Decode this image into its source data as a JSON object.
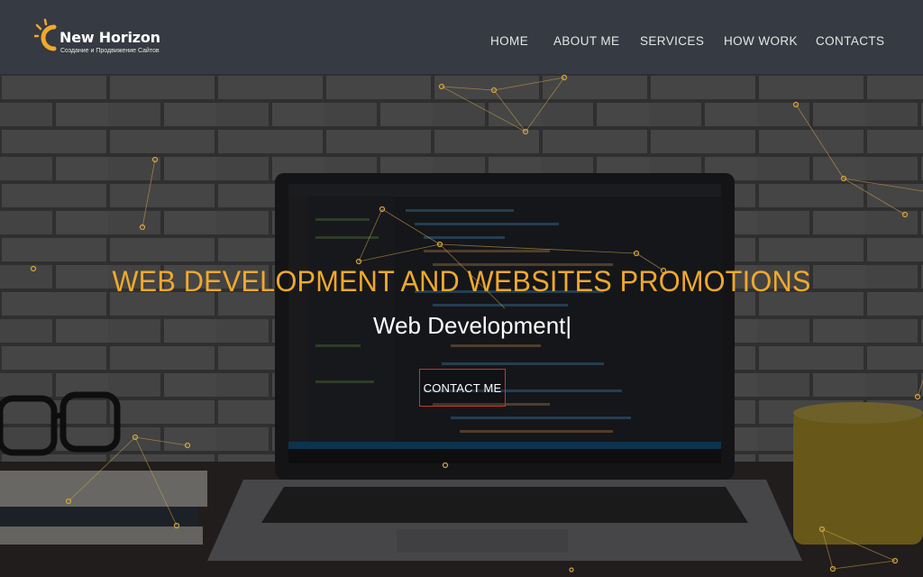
{
  "brand": {
    "name": "New Horizon",
    "tagline": "Создание и Продвижение Сайтов",
    "accent": "#f0a92c"
  },
  "nav": {
    "items": [
      {
        "label": "HOME"
      },
      {
        "label": "ABOUT ME"
      },
      {
        "label": "SERVICES"
      },
      {
        "label": "HOW WORK"
      },
      {
        "label": "CONTACTS"
      }
    ]
  },
  "hero": {
    "title": "WEB DEVELOPMENT AND WEBSITES PROMOTIONS",
    "typed_text": "Web Development",
    "cursor": "|",
    "button_label": "CONTACT ME",
    "button_border_color": "#c0392b",
    "header_bg": "#363a42"
  }
}
